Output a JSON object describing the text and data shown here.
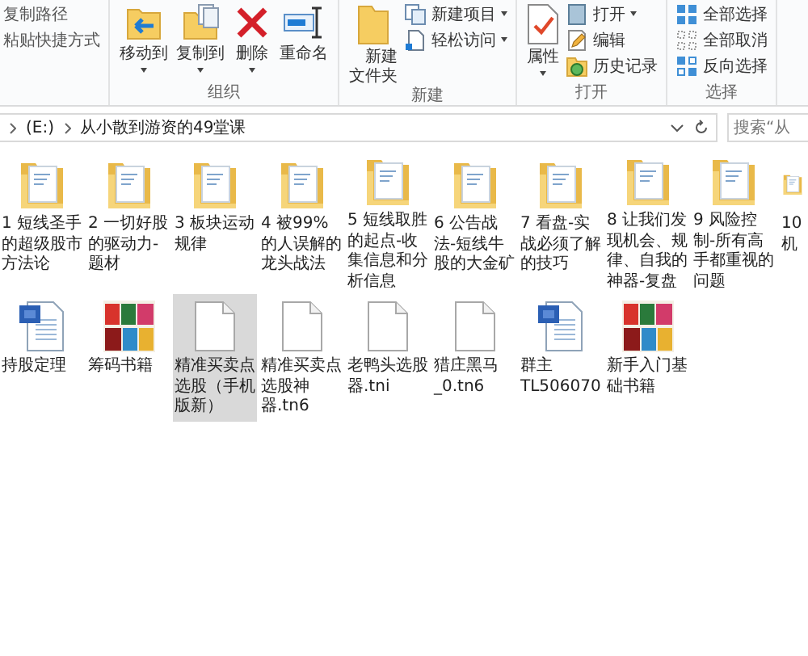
{
  "ribbon": {
    "groups": [
      {
        "items": [
          {
            "label": "复制路径",
            "kind": "small",
            "dropdown": false
          },
          {
            "label": "粘贴快捷方式",
            "kind": "small",
            "dropdown": false
          }
        ]
      },
      {
        "label": "组织",
        "items": [
          {
            "label": "移动到",
            "kind": "large",
            "dropdown": true
          },
          {
            "label": "复制到",
            "kind": "large",
            "dropdown": true
          },
          {
            "label": "删除",
            "kind": "large",
            "dropdown": true
          },
          {
            "label": "重命名",
            "kind": "large",
            "dropdown": false
          }
        ]
      },
      {
        "label": "新建",
        "items": [
          {
            "label": "新建文件夹",
            "kind": "large",
            "dropdown": false
          },
          {
            "label": "新建项目",
            "kind": "small",
            "dropdown": true
          },
          {
            "label": "轻松访问",
            "kind": "small",
            "dropdown": true
          }
        ]
      },
      {
        "label": "打开",
        "items": [
          {
            "label": "属性",
            "kind": "large",
            "dropdown": true
          },
          {
            "label": "打开",
            "kind": "small",
            "dropdown": true
          },
          {
            "label": "编辑",
            "kind": "small",
            "dropdown": false
          },
          {
            "label": "历史记录",
            "kind": "small",
            "dropdown": false
          }
        ]
      },
      {
        "label": "选择",
        "items": [
          {
            "label": "全部选择",
            "kind": "small",
            "dropdown": false
          },
          {
            "label": "全部取消",
            "kind": "small",
            "dropdown": false
          },
          {
            "label": "反向选择",
            "kind": "small",
            "dropdown": false
          }
        ]
      }
    ]
  },
  "address_bar": {
    "path": [
      "(E:)",
      "从小散到游资的49堂课"
    ]
  },
  "search": {
    "placeholder": "搜索“从"
  },
  "files": [
    {
      "name": "1 短线圣手的超级股市方法论",
      "kind": "folder",
      "selected": false
    },
    {
      "name": "2 一切好股的驱动力-题材",
      "kind": "folder",
      "selected": false
    },
    {
      "name": "3 板块运动规律",
      "kind": "folder",
      "selected": false
    },
    {
      "name": "4 被99%的人误解的龙头战法",
      "kind": "folder",
      "selected": false
    },
    {
      "name": "5 短线取胜的起点-收集信息和分析信息",
      "kind": "folder",
      "selected": false
    },
    {
      "name": "6 公告战法-短线牛股的大金矿",
      "kind": "folder",
      "selected": false
    },
    {
      "name": "7 看盘-实战必须了解的技巧",
      "kind": "folder",
      "selected": false
    },
    {
      "name": "8 让我们发现机会、规律、自我的神器-复盘",
      "kind": "folder",
      "selected": false
    },
    {
      "name": "9 风险控制-所有高手都重视的问题",
      "kind": "folder",
      "selected": false
    },
    {
      "name": "10 机",
      "kind": "folder",
      "selected": false
    },
    {
      "name": "持股定理",
      "kind": "word",
      "selected": false
    },
    {
      "name": "筹码书籍",
      "kind": "books",
      "selected": false
    },
    {
      "name": "精准买卖点选股（手机版新）",
      "kind": "file",
      "selected": true
    },
    {
      "name": "精准买卖点选股神器.tn6",
      "kind": "file",
      "selected": false
    },
    {
      "name": "老鸭头选股器.tni",
      "kind": "file",
      "selected": false
    },
    {
      "name": "猎庄黑马_0.tn6",
      "kind": "file",
      "selected": false
    },
    {
      "name": "群主TL506070",
      "kind": "word",
      "selected": false
    },
    {
      "name": "新手入门基础书籍",
      "kind": "books",
      "selected": false
    }
  ]
}
